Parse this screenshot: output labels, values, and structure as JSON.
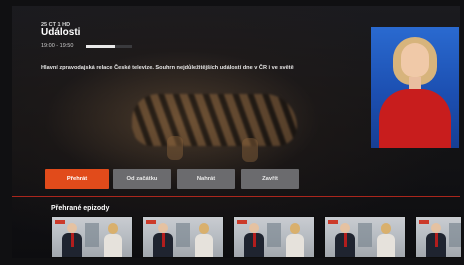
{
  "header": {
    "channel_line": "25 CT 1 HD",
    "title": "Události",
    "time_range": "19:00 - 19:50",
    "progress_fraction": 0.62,
    "description": "Hlavní zpravodajská relace České televize. Souhrn nejdůležitějších událostí dne v ČR i ve světě"
  },
  "actions": [
    {
      "label": "Přehrát",
      "style": "primary"
    },
    {
      "label": "Od začátku",
      "style": "secondary"
    },
    {
      "label": "Nahrát",
      "style": "secondary"
    },
    {
      "label": "Zavřít",
      "style": "secondary"
    }
  ],
  "episodes": {
    "title": "Přehrané epizody",
    "count_visible": 5
  },
  "colors": {
    "accent": "#e14b1b",
    "divider": "#c62a1e",
    "button_secondary": "#6b6b6e"
  }
}
